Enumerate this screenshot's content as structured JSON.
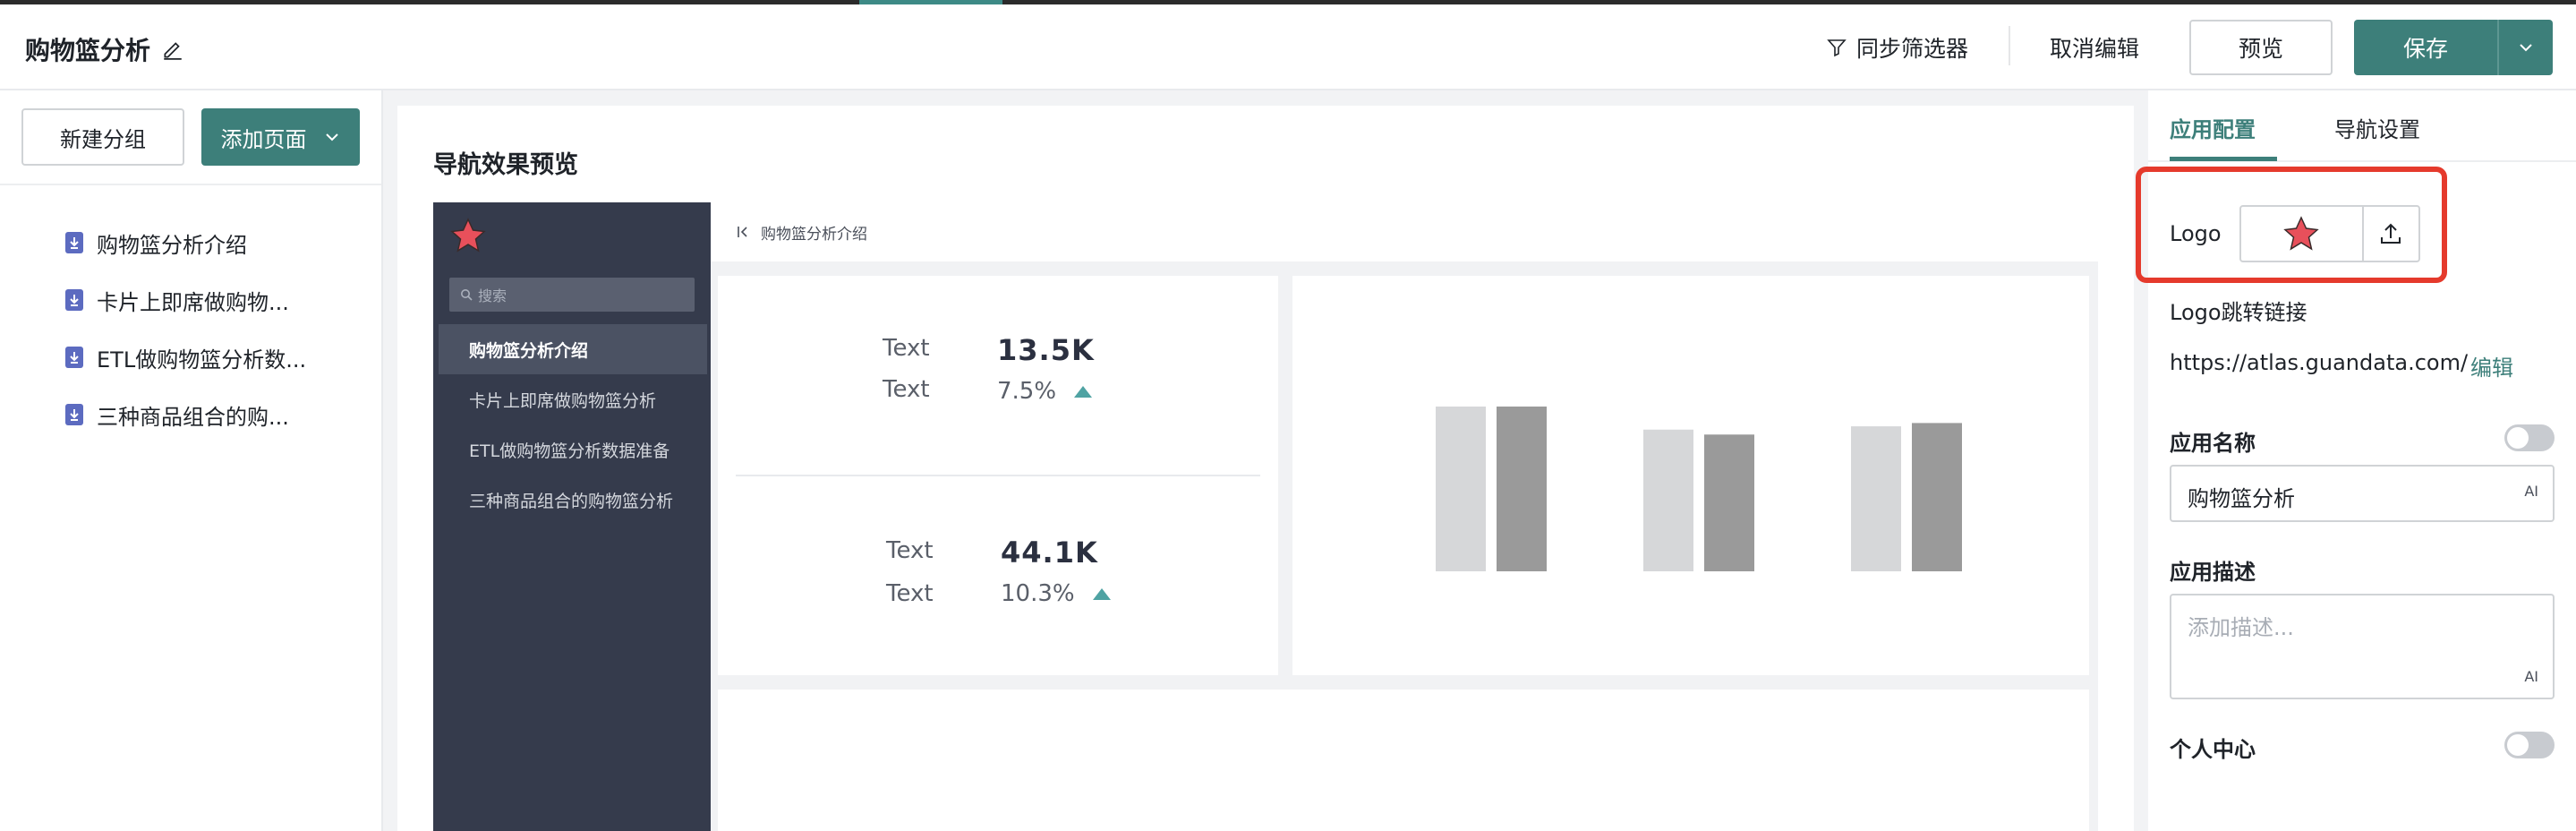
{
  "header": {
    "title": "购物篮分析",
    "sync_filter": "同步筛选器",
    "cancel_edit": "取消编辑",
    "preview": "预览",
    "save": "保存"
  },
  "left": {
    "new_group": "新建分组",
    "add_page": "添加页面",
    "pages": [
      "购物篮分析介绍",
      "卡片上即席做购物...",
      "ETL做购物篮分析数...",
      "三种商品组合的购..."
    ]
  },
  "center": {
    "title": "导航效果预览",
    "preview": {
      "search_placeholder": "搜索",
      "breadcrumb": "购物篮分析介绍",
      "nav": [
        "购物篮分析介绍",
        "卡片上即席做购物篮分析",
        "ETL做购物篮分析数据准备",
        "三种商品组合的购物篮分析"
      ],
      "kpi": [
        {
          "label1": "Text",
          "value": "13.5K",
          "label2": "Text",
          "pct": "7.5%"
        },
        {
          "label1": "Text",
          "value": "44.1K",
          "label2": "Text",
          "pct": "10.3%"
        }
      ],
      "bar_groups": [
        [
          100,
          100
        ],
        [
          86,
          83
        ],
        [
          88,
          90
        ]
      ]
    }
  },
  "right": {
    "tabs": [
      "应用配置",
      "导航设置"
    ],
    "logo_label": "Logo",
    "logo_link_label": "Logo跳转链接",
    "logo_link_value": "https://atlas.guandata.com/",
    "edit": "编辑",
    "app_name_label": "应用名称",
    "app_name_value": "购物篮分析",
    "app_desc_label": "应用描述",
    "app_desc_placeholder": "添加描述...",
    "personal_center_label": "个人中心",
    "ai_label": "AI"
  },
  "colors": {
    "primary": "#3d7f7a",
    "highlight": "#e53a2c",
    "preview_sidebar": "#353b4c"
  }
}
